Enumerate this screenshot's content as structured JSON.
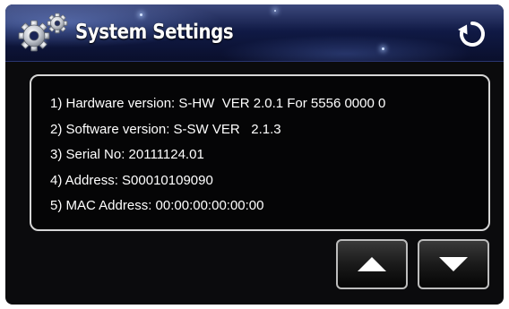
{
  "header": {
    "title": "System Settings",
    "icons": {
      "left": "gears-icon",
      "right": "refresh-icon"
    }
  },
  "info": {
    "lines": [
      "1) Hardware version: S-HW  VER 2.0.1 For 5556 0000 0",
      "2) Software version: S-SW VER   2.1.3",
      "3) Serial No: 20111124.01",
      "4) Address: S00010109090",
      "5) MAC Address: 00:00:00:00:00:00"
    ]
  },
  "nav": {
    "up_icon": "arrow-up-icon",
    "down_icon": "arrow-down-icon"
  },
  "colors": {
    "header_blue": "#1c2a66",
    "background": "#0b0b0d",
    "text": "#ffffff",
    "panel_border": "#d6d6d6"
  }
}
